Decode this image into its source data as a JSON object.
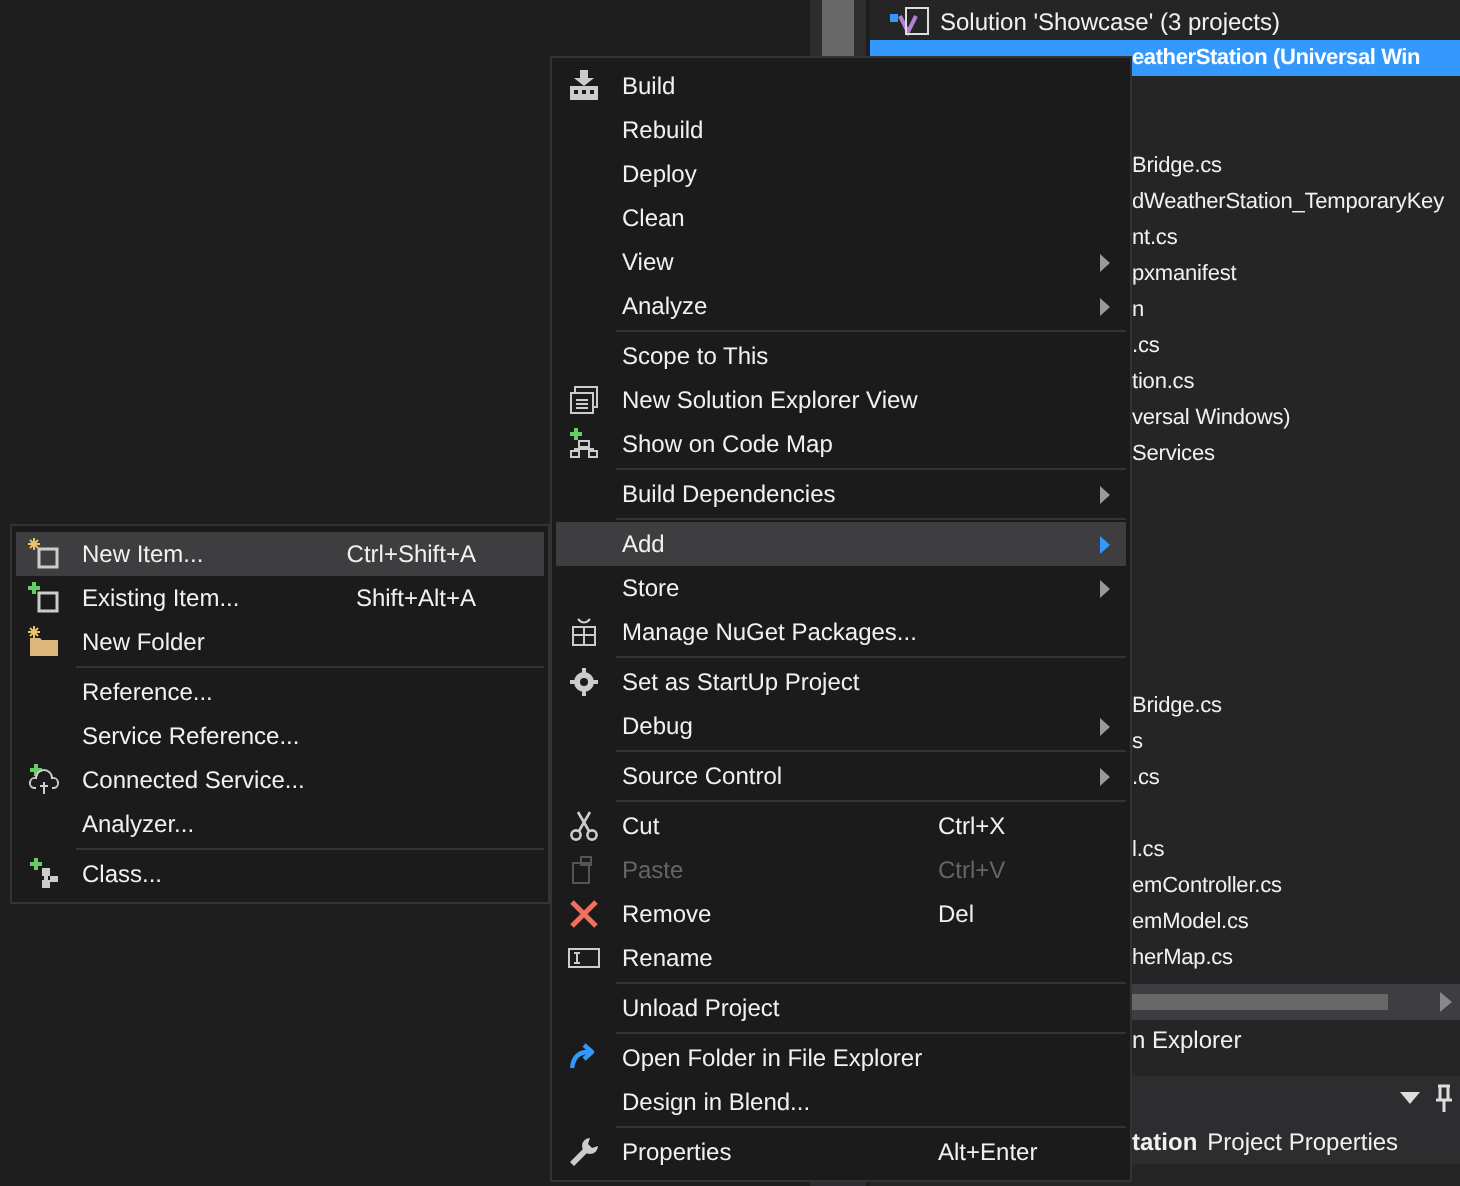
{
  "solution_explorer": {
    "solution_node": {
      "label": "Solution 'Showcase' (3 projects)"
    },
    "project_node": {
      "label": "eatherStation (Universal Win",
      "selected": true
    },
    "item_groups": [
      {
        "items": [
          "Bridge.cs",
          "dWeatherStation_TemporaryKey",
          "nt.cs",
          "pxmanifest",
          "n",
          ".cs",
          "tion.cs",
          "versal Windows)",
          "Services"
        ]
      },
      {
        "items": [
          "Bridge.cs",
          "s",
          ".cs"
        ]
      },
      {
        "items": [
          "l.cs",
          "emController.cs",
          "emModel.cs",
          "herMap.cs"
        ]
      }
    ],
    "panel_tab": {
      "label": "n Explorer"
    },
    "properties_header": {
      "title": "tation",
      "subtitle": "Project Properties"
    }
  },
  "context_menu": {
    "items": [
      {
        "kind": "command",
        "label": "Build",
        "submenu": false,
        "selected": false,
        "disabled": false
      },
      {
        "kind": "command",
        "label": "Rebuild",
        "submenu": false,
        "selected": false,
        "disabled": false
      },
      {
        "kind": "command",
        "label": "Deploy",
        "submenu": false,
        "selected": false,
        "disabled": false
      },
      {
        "kind": "command",
        "label": "Clean",
        "submenu": false,
        "selected": false,
        "disabled": false
      },
      {
        "kind": "command",
        "label": "View",
        "submenu": true,
        "selected": false,
        "disabled": false
      },
      {
        "kind": "command",
        "label": "Analyze",
        "submenu": true,
        "selected": false,
        "disabled": false
      },
      {
        "kind": "separator"
      },
      {
        "kind": "command",
        "label": "Scope to This",
        "submenu": false,
        "selected": false,
        "disabled": false
      },
      {
        "kind": "command",
        "label": "New Solution Explorer View",
        "submenu": false,
        "selected": false,
        "disabled": false
      },
      {
        "kind": "command",
        "label": "Show on Code Map",
        "submenu": false,
        "selected": false,
        "disabled": false
      },
      {
        "kind": "separator"
      },
      {
        "kind": "command",
        "label": "Build Dependencies",
        "submenu": true,
        "selected": false,
        "disabled": false
      },
      {
        "kind": "separator"
      },
      {
        "kind": "command",
        "label": "Add",
        "submenu": true,
        "selected": true,
        "disabled": false
      },
      {
        "kind": "command",
        "label": "Store",
        "submenu": true,
        "selected": false,
        "disabled": false
      },
      {
        "kind": "command",
        "label": "Manage NuGet Packages...",
        "submenu": false,
        "selected": false,
        "disabled": false
      },
      {
        "kind": "separator"
      },
      {
        "kind": "command",
        "label": "Set as StartUp Project",
        "submenu": false,
        "selected": false,
        "disabled": false
      },
      {
        "kind": "command",
        "label": "Debug",
        "submenu": true,
        "selected": false,
        "disabled": false
      },
      {
        "kind": "separator"
      },
      {
        "kind": "command",
        "label": "Source Control",
        "submenu": true,
        "selected": false,
        "disabled": false
      },
      {
        "kind": "separator"
      },
      {
        "kind": "command",
        "label": "Cut",
        "shortcut": "Ctrl+X",
        "submenu": false,
        "selected": false,
        "disabled": false
      },
      {
        "kind": "command",
        "label": "Paste",
        "shortcut": "Ctrl+V",
        "submenu": false,
        "selected": false,
        "disabled": true
      },
      {
        "kind": "command",
        "label": "Remove",
        "shortcut": "Del",
        "submenu": false,
        "selected": false,
        "disabled": false
      },
      {
        "kind": "command",
        "label": "Rename",
        "submenu": false,
        "selected": false,
        "disabled": false
      },
      {
        "kind": "separator"
      },
      {
        "kind": "command",
        "label": "Unload Project",
        "submenu": false,
        "selected": false,
        "disabled": false
      },
      {
        "kind": "separator"
      },
      {
        "kind": "command",
        "label": "Open Folder in File Explorer",
        "submenu": false,
        "selected": false,
        "disabled": false
      },
      {
        "kind": "command",
        "label": "Design in Blend...",
        "submenu": false,
        "selected": false,
        "disabled": false
      },
      {
        "kind": "separator"
      },
      {
        "kind": "command",
        "label": "Properties",
        "shortcut": "Alt+Enter",
        "submenu": false,
        "selected": false,
        "disabled": false
      }
    ]
  },
  "add_submenu": {
    "items": [
      {
        "kind": "command",
        "label": "New Item...",
        "shortcut": "Ctrl+Shift+A",
        "submenu": false,
        "selected": true,
        "disabled": false
      },
      {
        "kind": "command",
        "label": "Existing Item...",
        "shortcut": "Shift+Alt+A",
        "submenu": false,
        "selected": false,
        "disabled": false
      },
      {
        "kind": "command",
        "label": "New Folder",
        "submenu": false,
        "selected": false,
        "disabled": false
      },
      {
        "kind": "separator"
      },
      {
        "kind": "command",
        "label": "Reference...",
        "submenu": false,
        "selected": false,
        "disabled": false
      },
      {
        "kind": "command",
        "label": "Service Reference...",
        "submenu": false,
        "selected": false,
        "disabled": false
      },
      {
        "kind": "command",
        "label": "Connected Service...",
        "submenu": false,
        "selected": false,
        "disabled": false
      },
      {
        "kind": "command",
        "label": "Analyzer...",
        "submenu": false,
        "selected": false,
        "disabled": false
      },
      {
        "kind": "separator"
      },
      {
        "kind": "command",
        "label": "Class...",
        "submenu": false,
        "selected": false,
        "disabled": false
      }
    ]
  }
}
